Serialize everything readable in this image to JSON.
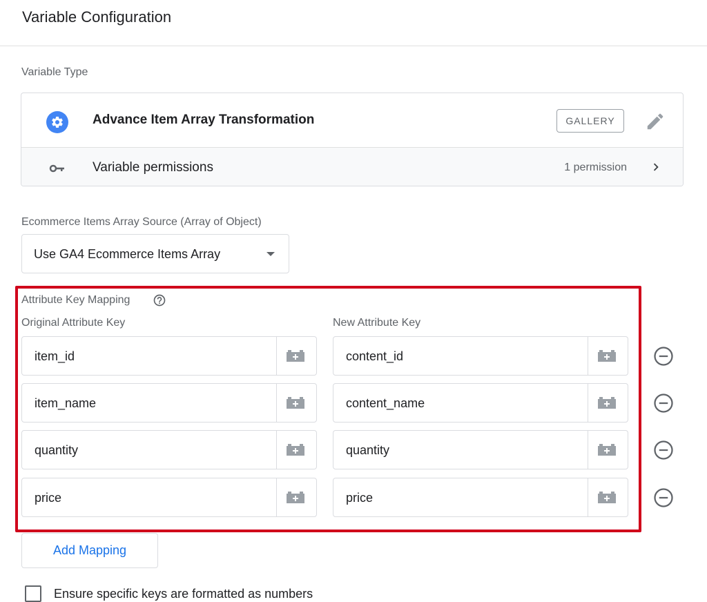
{
  "header": {
    "title": "Variable Configuration"
  },
  "variable_type": {
    "label": "Variable Type",
    "name": "Advance Item Array Transformation",
    "badge": "GALLERY",
    "icon": "gear-icon",
    "edit_icon": "pencil-icon",
    "permissions": {
      "label": "Variable permissions",
      "count": "1 permission",
      "icon": "key-icon"
    }
  },
  "source": {
    "label": "Ecommerce Items Array Source (Array of Object)",
    "selected": "Use GA4 Ecommerce Items Array"
  },
  "mapping": {
    "label": "Attribute Key Mapping",
    "col_original": "Original Attribute Key",
    "col_new": "New Attribute Key",
    "rows": [
      {
        "original": "item_id",
        "new": "content_id"
      },
      {
        "original": "item_name",
        "new": "content_name"
      },
      {
        "original": "quantity",
        "new": "quantity"
      },
      {
        "original": "price",
        "new": "price"
      }
    ],
    "add_button": "Add Mapping",
    "highlight_color": "#d0021b"
  },
  "numbers_option": {
    "label": "Ensure specific keys are formatted as numbers",
    "checked": false
  },
  "colors": {
    "accent": "#1a73e8",
    "gear": "#4285f4"
  }
}
